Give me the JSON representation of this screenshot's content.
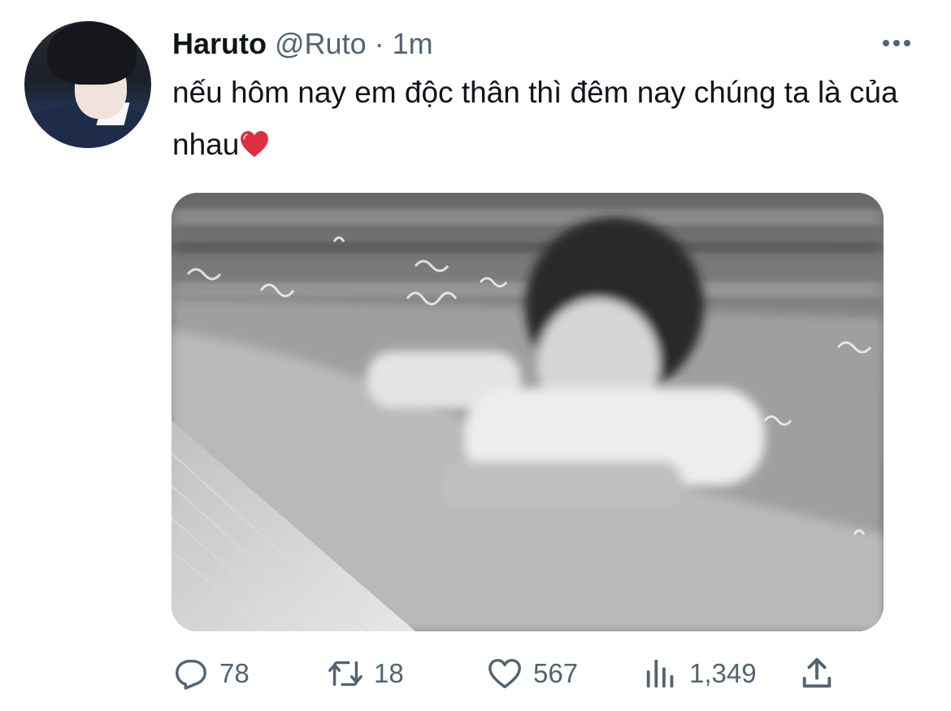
{
  "tweet": {
    "author_name": "Haruto",
    "handle": "@Ruto",
    "separator": "·",
    "time": "1m",
    "text": "nếu hôm nay em độc thân thì đêm nay chúng ta là của nhau",
    "emoji": "heart-red"
  },
  "actions": {
    "replies": "78",
    "retweets": "18",
    "likes": "567",
    "views": "1,349"
  },
  "icons": {
    "reply": "reply-icon",
    "retweet": "retweet-icon",
    "like": "heart-icon",
    "views": "views-icon",
    "share": "share-icon",
    "more": "more-icon"
  },
  "colors": {
    "text_primary": "#0f1419",
    "text_secondary": "#536471",
    "heart_emoji": "#e0245e"
  }
}
